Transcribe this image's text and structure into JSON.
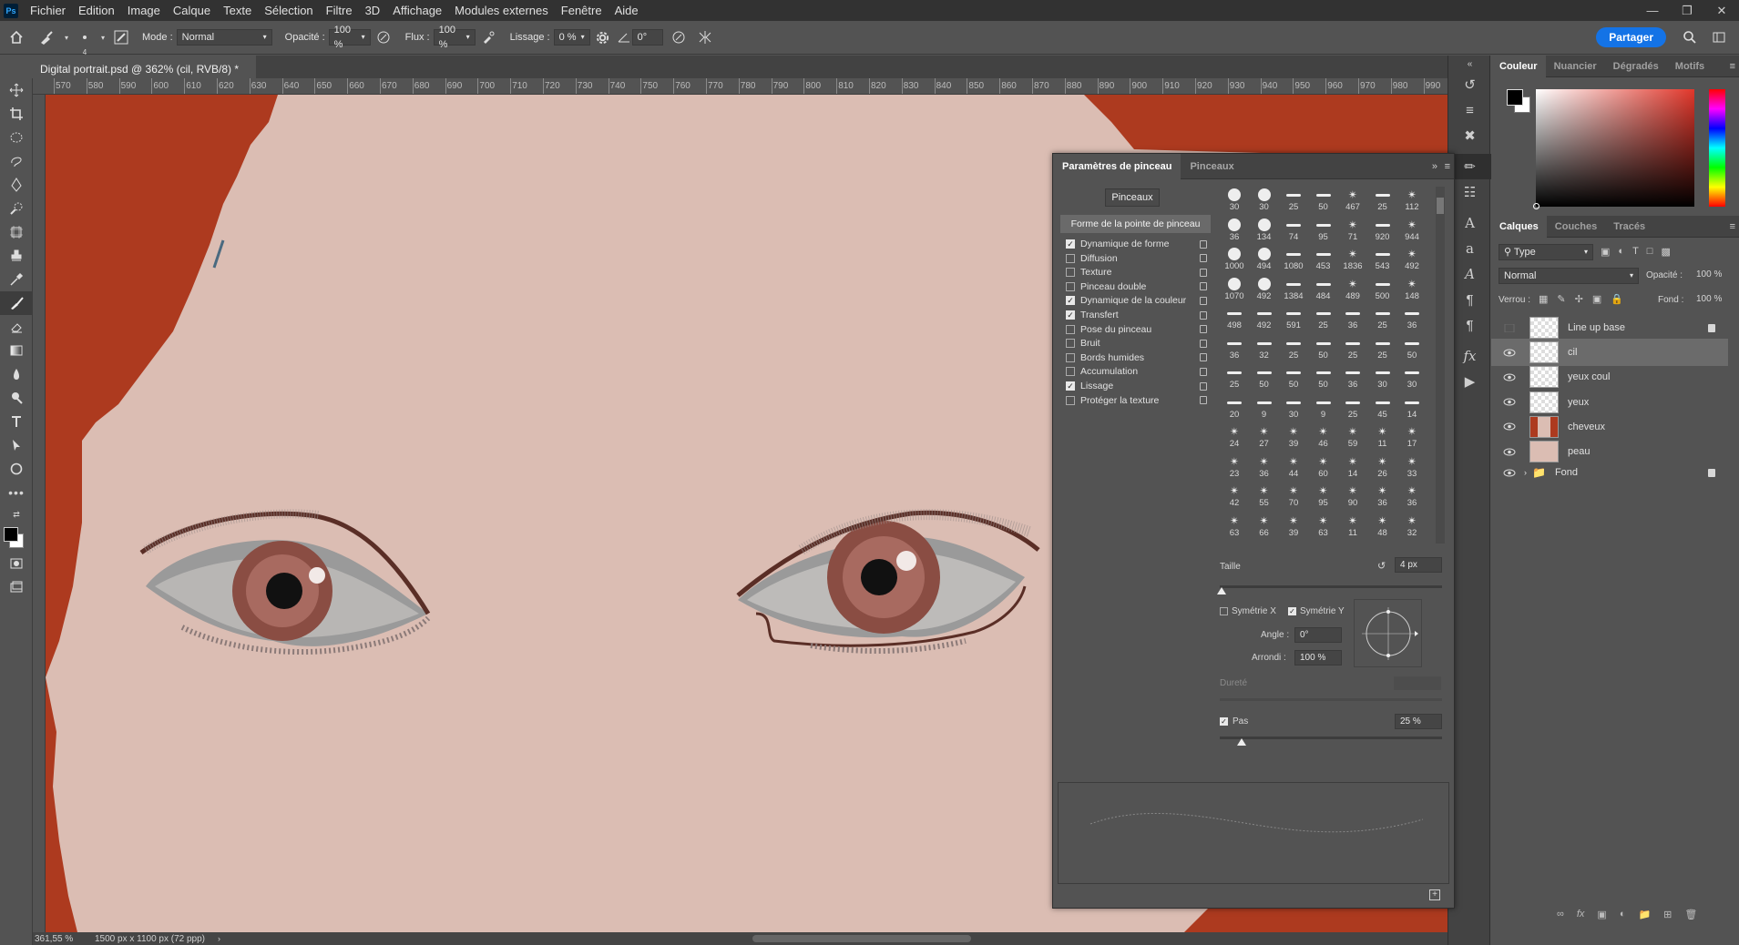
{
  "menubar": {
    "logo": "Ps",
    "items": [
      "Fichier",
      "Edition",
      "Image",
      "Calque",
      "Texte",
      "Sélection",
      "Filtre",
      "3D",
      "Affichage",
      "Modules externes",
      "Fenêtre",
      "Aide"
    ]
  },
  "options": {
    "brush_size": "4",
    "mode_label": "Mode :",
    "mode_value": "Normal",
    "opacity_label": "Opacité :",
    "opacity_value": "100 %",
    "flow_label": "Flux :",
    "flow_value": "100 %",
    "smoothing_label": "Lissage :",
    "smoothing_value": "0 %",
    "angle_value": "0°",
    "share_label": "Partager"
  },
  "document": {
    "tab_title": "Digital portrait.psd @ 362% (cil, RVB/8) *",
    "close_glyph": "×",
    "zoom": "361,55 %",
    "size_info": "1500 px x 1100 px (72 ppp)"
  },
  "ruler": {
    "h_ticks": [
      "570",
      "580",
      "590",
      "600",
      "610",
      "620",
      "630",
      "640",
      "650",
      "660",
      "670",
      "680",
      "690",
      "700",
      "710",
      "720",
      "730",
      "740",
      "750",
      "760",
      "770",
      "780",
      "790",
      "800",
      "810",
      "820",
      "830",
      "840",
      "850",
      "860",
      "870",
      "880",
      "890",
      "900",
      "910",
      "920",
      "930",
      "940",
      "950",
      "960",
      "970",
      "980",
      "990"
    ]
  },
  "brush_panel": {
    "tab_settings": "Paramètres de pinceau",
    "tab_brushes": "Pinceaux",
    "brushes_button": "Pinceaux",
    "tip_shape": "Forme de la pointe de pinceau",
    "options": [
      {
        "label": "Dynamique de forme",
        "checked": true
      },
      {
        "label": "Diffusion",
        "checked": false
      },
      {
        "label": "Texture",
        "checked": false
      },
      {
        "label": "Pinceau double",
        "checked": false
      },
      {
        "label": "Dynamique de la couleur",
        "checked": true
      },
      {
        "label": "Transfert",
        "checked": true
      },
      {
        "label": "Pose du pinceau",
        "checked": false
      },
      {
        "label": "Bruit",
        "checked": false
      },
      {
        "label": "Bords humides",
        "checked": false
      },
      {
        "label": "Accumulation",
        "checked": false
      },
      {
        "label": "Lissage",
        "checked": true
      },
      {
        "label": "Protéger la texture",
        "checked": false
      }
    ],
    "brush_sizes": [
      "30",
      "30",
      "25",
      "50",
      "467",
      "25",
      "112",
      "36",
      "134",
      "74",
      "95",
      "71",
      "920",
      "944",
      "1000",
      "494",
      "1080",
      "453",
      "1836",
      "543",
      "492",
      "1070",
      "492",
      "1384",
      "484",
      "489",
      "500",
      "148",
      "498",
      "492",
      "591",
      "25",
      "36",
      "25",
      "36",
      "36",
      "32",
      "25",
      "50",
      "25",
      "25",
      "50",
      "25",
      "50",
      "50",
      "50",
      "36",
      "30",
      "30",
      "20",
      "9",
      "30",
      "9",
      "25",
      "45",
      "14",
      "24",
      "27",
      "39",
      "46",
      "59",
      "11",
      "17",
      "23",
      "36",
      "44",
      "60",
      "14",
      "26",
      "33",
      "42",
      "55",
      "70",
      "95",
      "90",
      "36",
      "36",
      "63",
      "66",
      "39",
      "63",
      "11",
      "48",
      "32"
    ],
    "size_label": "Taille",
    "size_value": "4 px",
    "symx_label": "Symétrie X",
    "symy_label": "Symétrie Y",
    "angle_label": "Angle :",
    "angle_value": "0°",
    "roundness_label": "Arrondi :",
    "roundness_value": "100 %",
    "hardness_label": "Dureté",
    "spacing_label": "Pas",
    "spacing_value": "25 %",
    "size_fraction": 0.01,
    "spacing_fraction": 0.1
  },
  "color_panel": {
    "tabs": [
      "Couleur",
      "Nuancier",
      "Dégradés",
      "Motifs"
    ],
    "foreground": "#000000",
    "background": "#ffffff",
    "hue": "#e1372b"
  },
  "layers_panel": {
    "tabs": [
      "Calques",
      "Couches",
      "Tracés"
    ],
    "filter_label": "Type",
    "blend_mode": "Normal",
    "opacity_label": "Opacité :",
    "opacity_value": "100 %",
    "lock_label": "Verrou :",
    "fill_label": "Fond :",
    "fill_value": "100 %",
    "layers": [
      {
        "name": "Line up base",
        "visible": false,
        "locked": true,
        "selected": false
      },
      {
        "name": "cil",
        "visible": true,
        "locked": false,
        "selected": true
      },
      {
        "name": "yeux coul",
        "visible": true,
        "locked": false,
        "selected": false
      },
      {
        "name": "yeux",
        "visible": true,
        "locked": false,
        "selected": false
      },
      {
        "name": "cheveux",
        "visible": true,
        "locked": false,
        "selected": false
      },
      {
        "name": "peau",
        "visible": true,
        "locked": false,
        "selected": false
      },
      {
        "name": "Fond",
        "visible": true,
        "locked": true,
        "selected": false,
        "group": true
      }
    ]
  },
  "colors": {
    "skin": "#dbbdb3",
    "hair": "#ad3a1f",
    "accent": "#1473e6"
  }
}
